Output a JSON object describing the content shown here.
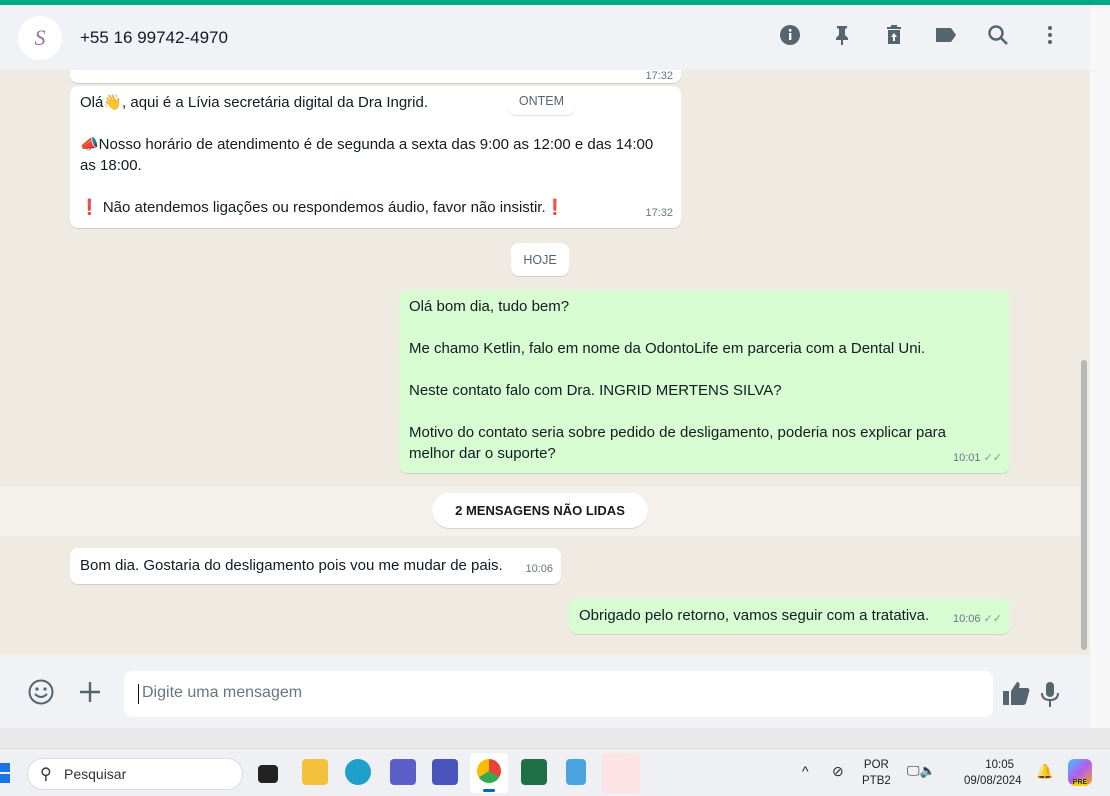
{
  "header": {
    "contact": "+55 16 99742-4970",
    "avatar_text": "S",
    "icons": [
      "info-icon",
      "pin-icon",
      "delete-icon",
      "label-icon",
      "search-icon",
      "menu-icon"
    ]
  },
  "messages": [
    {
      "dir": "in",
      "partial": true,
      "time": "17:32"
    },
    {
      "dir": "in",
      "lines": [
        "Olá👋, aqui é a Lívia secretária digital da Dra Ingrid.",
        "📣Nosso horário de atendimento é de segunda a sexta das 9:00 as 12:00 e das 14:00 as 18:00.",
        "❗ Não atendemos ligações ou respondemos áudio, favor não insistir.❗"
      ],
      "time": "17:32"
    },
    {
      "dir": "out",
      "lines": [
        "Olá bom dia, tudo bem?",
        "Me chamo Ketlin, falo em nome da OdontoLife em parceria com a Dental Uni.",
        "Neste contato falo com Dra. INGRID MERTENS SILVA?",
        "Motivo do contato seria sobre pedido de desligamento, poderia nos explicar para melhor dar o suporte?"
      ],
      "time": "10:01",
      "ticks": "✓✓"
    },
    {
      "dir": "in",
      "lines": [
        "Bom dia. Gostaria do desligamento pois vou me mudar de pais."
      ],
      "time": "10:06"
    },
    {
      "dir": "out",
      "lines": [
        "Obrigado pelo retorno, vamos seguir com a tratativa."
      ],
      "time": "10:06",
      "ticks": "✓✓"
    }
  ],
  "dates": {
    "yesterday": "ONTEM",
    "today": "HOJE"
  },
  "unread_label": "2 MENSAGENS NÃO LIDAS",
  "composer": {
    "placeholder": "Digite uma mensagem"
  },
  "taskbar": {
    "search": "Pesquisar",
    "lang": "POR",
    "layout": "PTB2",
    "time": "10:05",
    "date": "09/08/2024",
    "copilot_badge": "PRE"
  },
  "colors": {
    "accent": "#00a884",
    "outgoing": "#d9fdd3",
    "incoming": "#ffffff"
  }
}
